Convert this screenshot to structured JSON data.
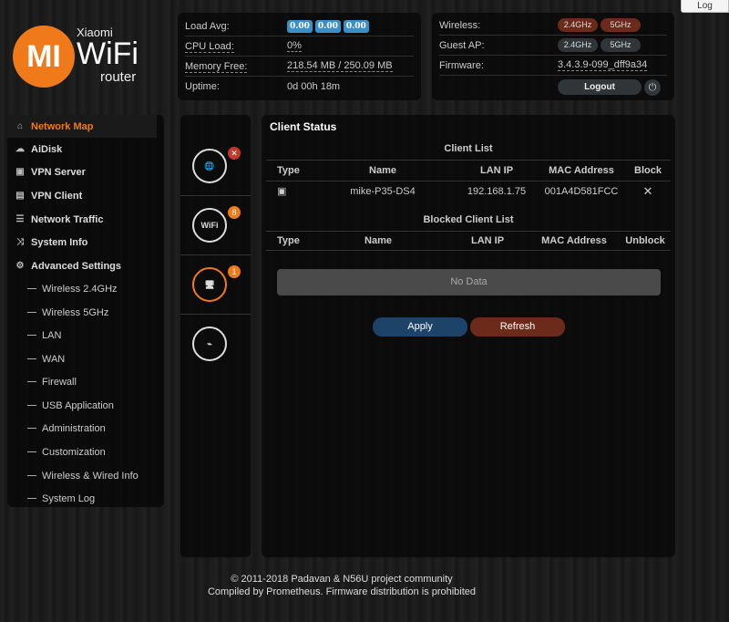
{
  "log_button": "Log",
  "logo": {
    "brand": "Xiaomi",
    "product": "WiFi",
    "sub": "router",
    "mark": "MI",
    "color": "#f07a1a"
  },
  "sidebar": {
    "items": [
      {
        "label": "Network Map",
        "icon": "home-icon",
        "active": true
      },
      {
        "label": "AiDisk",
        "icon": "cloud-icon"
      },
      {
        "label": "VPN Server",
        "icon": "vpn-server-icon"
      },
      {
        "label": "VPN Client",
        "icon": "lock-icon"
      },
      {
        "label": "Network Traffic",
        "icon": "list-icon"
      },
      {
        "label": "System Info",
        "icon": "shuffle-icon"
      },
      {
        "label": "Advanced Settings",
        "icon": "gear-icon"
      }
    ],
    "sub_items": [
      "Wireless 2.4GHz",
      "Wireless 5GHz",
      "LAN",
      "WAN",
      "Firewall",
      "USB Application",
      "Administration",
      "Customization",
      "Wireless & Wired Info",
      "System Log"
    ]
  },
  "status": {
    "load_avg_label": "Load Avg:",
    "load_avg": [
      "0.00",
      "0.00",
      "0.00"
    ],
    "cpu_label": "CPU Load:",
    "cpu": "0%",
    "mem_label": "Memory Free:",
    "mem": "218.54 MB / 250.09 MB",
    "uptime_label": "Uptime:",
    "uptime": "0d 00h 18m",
    "wireless_label": "Wireless:",
    "wireless": [
      "2.4GHz",
      "5GHz"
    ],
    "guest_label": "Guest AP:",
    "guest": [
      "2.4GHz",
      "5GHz"
    ],
    "firmware_label": "Firmware:",
    "firmware": "3.4.3.9-099_dff9a34",
    "logout": "Logout"
  },
  "netmap": {
    "wifi_icon_text": "WiFi",
    "wifi_badge": "8",
    "clients_badge": "1"
  },
  "client_status": {
    "title": "Client Status",
    "client_list_title": "Client List",
    "headers": [
      "Type",
      "Name",
      "LAN IP",
      "MAC Address",
      "Block"
    ],
    "rows": [
      {
        "name": "mike-P35-DS4",
        "ip": "192.168.1.75",
        "mac": "001A4D581FCC"
      }
    ],
    "blocked_title": "Blocked Client List",
    "blocked_headers": [
      "Type",
      "Name",
      "LAN IP",
      "MAC Address",
      "Unblock"
    ],
    "no_data": "No Data",
    "apply": "Apply",
    "refresh": "Refresh"
  },
  "footer": {
    "line1": "© 2011-2018 Padavan & N56U project community",
    "line2": "Compiled by Prometheus. Firmware distribution is prohibited"
  }
}
